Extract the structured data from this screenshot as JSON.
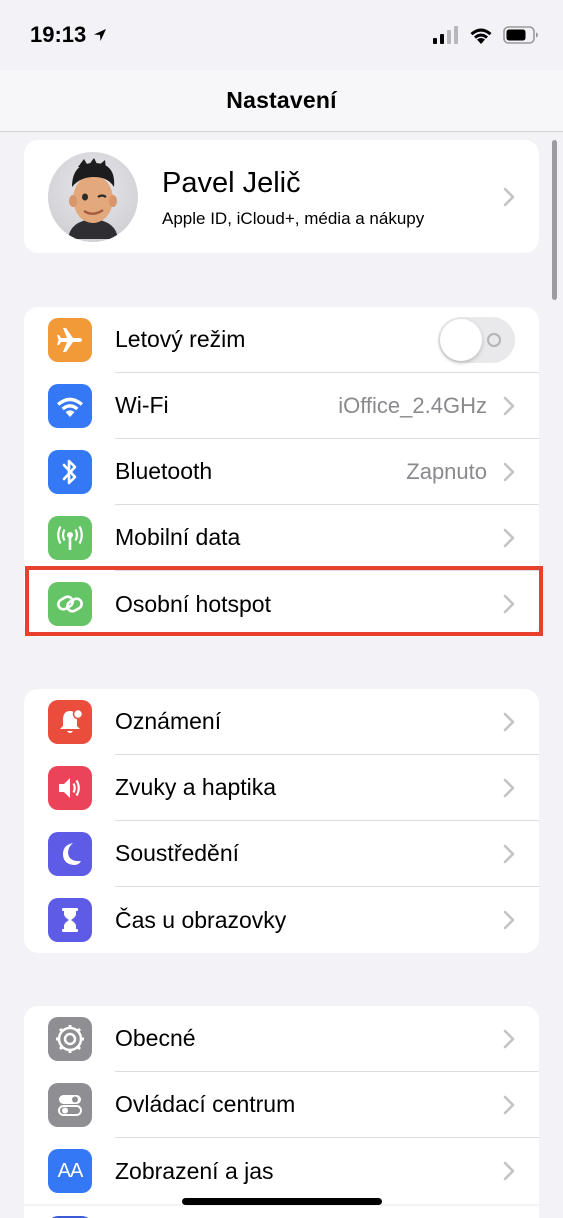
{
  "status": {
    "time": "19:13"
  },
  "nav": {
    "title": "Nastavení"
  },
  "profile": {
    "name": "Pavel Jelič",
    "subtitle": "Apple ID, iCloud+, média a nákupy"
  },
  "group1": [
    {
      "label": "Letový režim",
      "icon": "airplane-icon",
      "color": "#f19a37",
      "toggle": false
    },
    {
      "label": "Wi-Fi",
      "value": "iOffice_2.4GHz",
      "icon": "wifi-icon",
      "color": "#3478f6"
    },
    {
      "label": "Bluetooth",
      "value": "Zapnuto",
      "icon": "bluetooth-icon",
      "color": "#3478f6"
    },
    {
      "label": "Mobilní data",
      "icon": "antenna-icon",
      "color": "#65c466"
    },
    {
      "label": "Osobní hotspot",
      "icon": "hotspot-icon",
      "color": "#65c466"
    }
  ],
  "group2": [
    {
      "label": "Oznámení",
      "icon": "bell-icon",
      "color": "#eb4d3d"
    },
    {
      "label": "Zvuky a haptika",
      "icon": "speaker-icon",
      "color": "#eb445a"
    },
    {
      "label": "Soustředění",
      "icon": "moon-icon",
      "color": "#5e5ce6"
    },
    {
      "label": "Čas u obrazovky",
      "icon": "hourglass-icon",
      "color": "#5e5ce6"
    }
  ],
  "group3": [
    {
      "label": "Obecné",
      "icon": "gear-icon",
      "color": "#8e8e93"
    },
    {
      "label": "Ovládací centrum",
      "icon": "switches-icon",
      "color": "#8e8e93"
    },
    {
      "label": "Zobrazení a jas",
      "icon": "text-size-icon",
      "color": "#3478f6",
      "glyph": "AA"
    }
  ],
  "colors": {
    "highlight": "#e8402c",
    "background": "#f2f2f7"
  }
}
